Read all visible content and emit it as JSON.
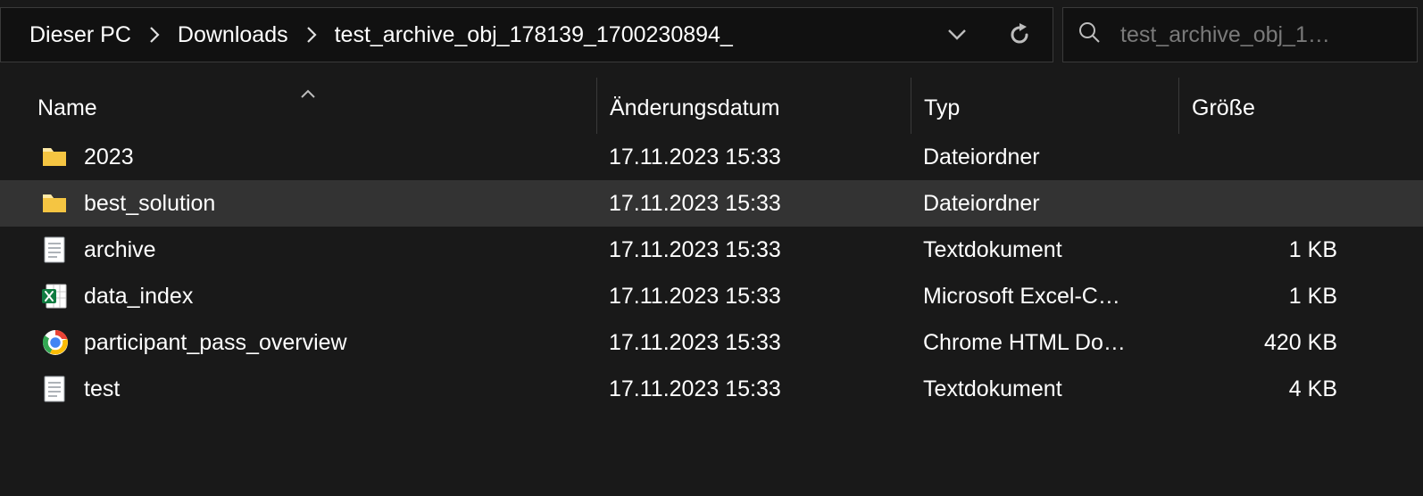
{
  "breadcrumbs": [
    {
      "label": "Dieser PC"
    },
    {
      "label": "Downloads"
    },
    {
      "label": "test_archive_obj_178139_1700230894_"
    }
  ],
  "search": {
    "placeholder": "test_archive_obj_1…"
  },
  "columns": {
    "name": "Name",
    "date": "Änderungsdatum",
    "type": "Typ",
    "size": "Größe"
  },
  "sort": {
    "column": "name",
    "direction": "asc"
  },
  "rows": [
    {
      "icon": "folder",
      "name": "2023",
      "date": "17.11.2023 15:33",
      "type": "Dateiordner",
      "size": "",
      "selected": false
    },
    {
      "icon": "folder",
      "name": "best_solution",
      "date": "17.11.2023 15:33",
      "type": "Dateiordner",
      "size": "",
      "selected": true
    },
    {
      "icon": "text",
      "name": "archive",
      "date": "17.11.2023 15:33",
      "type": "Textdokument",
      "size": "1 KB",
      "selected": false
    },
    {
      "icon": "excel",
      "name": "data_index",
      "date": "17.11.2023 15:33",
      "type": "Microsoft Excel-C…",
      "size": "1 KB",
      "selected": false
    },
    {
      "icon": "chrome",
      "name": "participant_pass_overview",
      "date": "17.11.2023 15:33",
      "type": "Chrome HTML Do…",
      "size": "420 KB",
      "selected": false
    },
    {
      "icon": "text",
      "name": "test",
      "date": "17.11.2023 15:33",
      "type": "Textdokument",
      "size": "4 KB",
      "selected": false
    }
  ]
}
